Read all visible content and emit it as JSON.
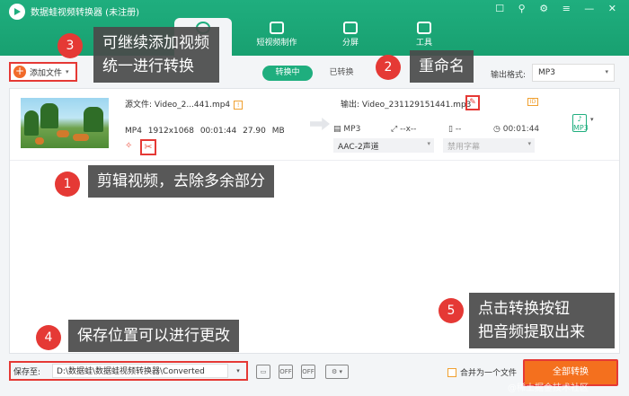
{
  "app": {
    "title": "数据蛙视频转换器 (未注册)",
    "window_controls": "☐ ⚲ ⚙ ≡ — ✕",
    "nav_tabs": [
      {
        "label": ""
      },
      {
        "label": "短视频制作"
      },
      {
        "label": "分屏"
      },
      {
        "label": "工具"
      }
    ]
  },
  "toolbar": {
    "add_file_label": "添加文件",
    "add_file_dropdown": "▾",
    "tab_converting": "转换中",
    "tab_converted": "已转换",
    "output_format_label": "输出格式:",
    "output_format_value": "MP3",
    "dropdown_arrow": "▾"
  },
  "file_row": {
    "source_label": "源文件: Video_2...441.mp4",
    "warn_glyph": "!",
    "source_format": "MP4",
    "source_resolution": "1912x1068",
    "source_duration": "00:01:44",
    "source_size": "27.90 MB",
    "effect_glyph": "✧",
    "cut_glyph": "✂",
    "output_label": "输出: Video_231129151441.mp3",
    "edit_glyph": "✎",
    "id_glyph": "ID",
    "out_format": "MP3",
    "out_resolution": "--x--",
    "out_size": "--",
    "out_duration": "00:01:44",
    "audio_channel": "AAC-2声道",
    "subtitle": "禁用字幕",
    "format_icon_label": "♪ MP3",
    "dropdown_arrow": "▾"
  },
  "bottom": {
    "save_label": "保存至:",
    "save_path": "D:\\数据蛙\\数据蛙视频转换器\\Converted",
    "merge_label": "合并为一个文件",
    "convert_all": "全部转换",
    "off_label": "OFF",
    "gear_glyph": "⚙ ▾",
    "folder_glyph": "▭",
    "dropdown_arrow": "▾"
  },
  "callouts": [
    {
      "num": "1",
      "text": "剪辑视频，去除多余部分"
    },
    {
      "num": "2",
      "text": "重命名"
    },
    {
      "num": "3",
      "text": "可继续添加视频\n统一进行转换"
    },
    {
      "num": "4",
      "text": "保存位置可以进行更改"
    },
    {
      "num": "5",
      "text": "点击转换按钮\n把音频提取出来"
    }
  ],
  "watermark": "@稀土掘金技术社区",
  "colors": {
    "brand_green": "#1fae7e",
    "accent_orange": "#f4701e",
    "highlight_red": "#e53935"
  }
}
